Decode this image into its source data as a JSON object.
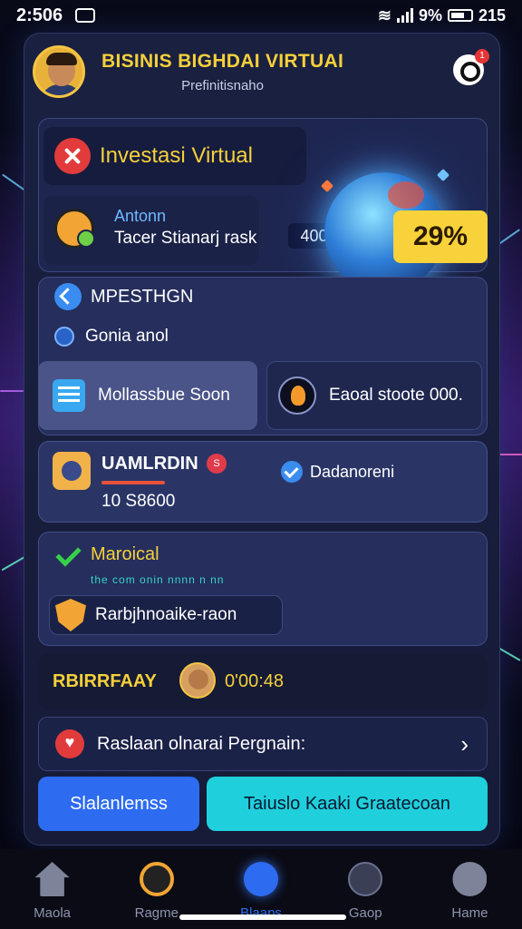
{
  "status_bar": {
    "time": "2:506",
    "battery": "9%",
    "right_time": "215"
  },
  "header": {
    "title": "BISINIS BIGHDAI VIRTUAI",
    "subtitle": "Prefinitisnaho"
  },
  "notification": {
    "count": "1"
  },
  "invest": {
    "title": "Investasi Virtual",
    "user_name": "Antonn",
    "user_task": "Tacer Stianarj rask",
    "amount": "400.DEN",
    "percent": "29%"
  },
  "mid": {
    "heading": "MPESTHGN",
    "subheading": "Gonia anol",
    "left_button": "Mollassbue Soon",
    "right_button": "Eaoal stoote 000."
  },
  "value": {
    "title": "UAMLRDIN",
    "badge": "S",
    "number": "10 S8600",
    "right_label": "Dadanoreni"
  },
  "manual": {
    "title": "Maroical",
    "subtitle": "the com onin nnnn n nn",
    "action": "Rarbjhnoaike-raon"
  },
  "strip": {
    "title": "RBIRRFAAY",
    "time": "0'00:48"
  },
  "link": {
    "label": "Raslaan olnarai Pergnain:",
    "chevron": "›"
  },
  "buttons": {
    "primary": "Slalanlemss",
    "secondary": "Taiuslo Kaaki Graatecoan"
  },
  "nav": [
    {
      "label": "Maola",
      "icon": "home-icon"
    },
    {
      "label": "Ragme",
      "icon": "search-icon"
    },
    {
      "label": "Blaaps",
      "icon": "active-icon"
    },
    {
      "label": "Gaop",
      "icon": "badge-icon"
    },
    {
      "label": "Hame",
      "icon": "user-icon"
    }
  ]
}
